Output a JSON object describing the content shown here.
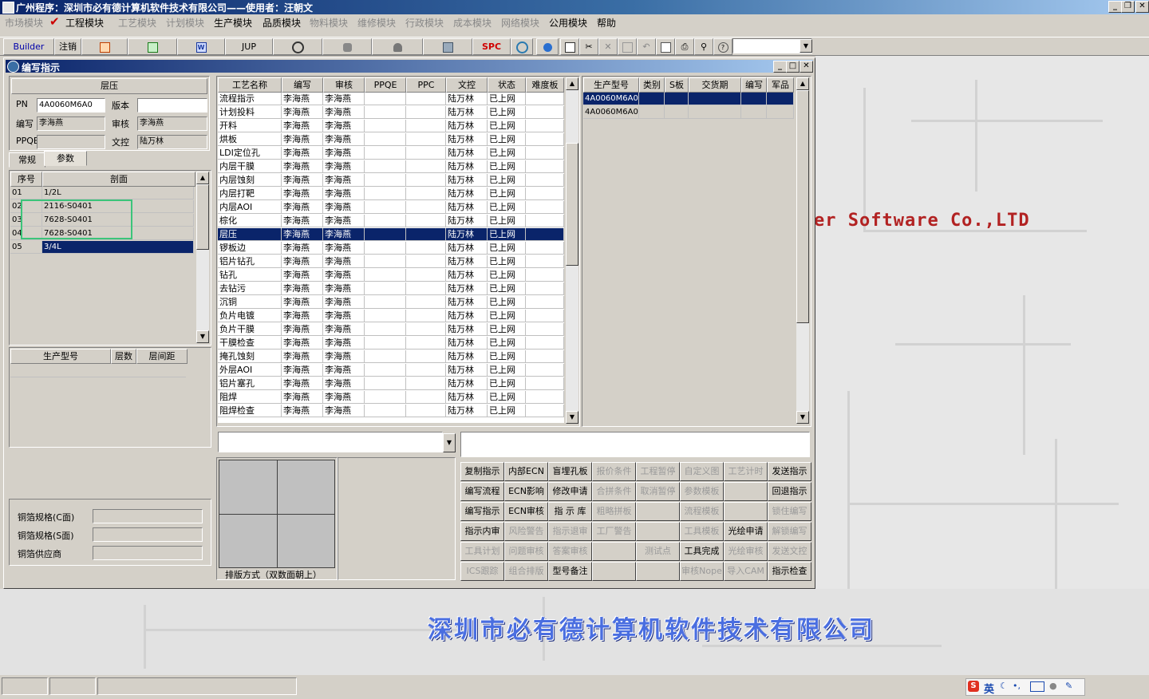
{
  "window": {
    "title": "广州程序：深圳市必有德计算机软件技术有限公司——使用者：汪朝文"
  },
  "menu": {
    "items": [
      "市场模块",
      "工程模块",
      "工艺模块",
      "计划模块",
      "生产模块",
      "品质模块",
      "物料模块",
      "维修模块",
      "行政模块",
      "成本模块",
      "网络模块",
      "公用模块",
      "帮助"
    ]
  },
  "toolbar": {
    "builder": "Builder",
    "logout": "注销",
    "jup": "JUP",
    "spc": "SPC"
  },
  "child": {
    "title": "编写指示"
  },
  "left": {
    "section_title": "层压",
    "pn_label": "PN",
    "pn_value": "4A0060M6A0",
    "version_label": "版本",
    "version_value": "",
    "author_label": "编写",
    "author_value": "李海燕",
    "review_label": "审核",
    "review_value": "李海燕",
    "ppqe_label": "PPQE",
    "ppqe_value": "",
    "doc_label": "文控",
    "doc_value": "陆万林",
    "tabs": [
      "常规",
      "参数"
    ],
    "stack_headers": [
      "序号",
      "剖面"
    ],
    "stack_rows": [
      [
        "01",
        "1/2L"
      ],
      [
        "02",
        "2116-S0401"
      ],
      [
        "03",
        "7628-S0401"
      ],
      [
        "04",
        "7628-S0401"
      ],
      [
        "05",
        "3/4L"
      ]
    ],
    "model_headers": [
      "生产型号",
      "层数",
      "层间距"
    ],
    "copper_c_label": "铜箔规格(C面)",
    "copper_s_label": "铜箔规格(S面)",
    "copper_supplier_label": "铜箔供应商"
  },
  "process": {
    "headers": [
      "工艺名称",
      "编写",
      "审核",
      "PPQE",
      "PPC",
      "文控",
      "状态",
      "难度板"
    ],
    "rows": [
      [
        "流程指示",
        "李海燕",
        "李海燕",
        "",
        "",
        "陆万林",
        "已上网",
        ""
      ],
      [
        "计划投料",
        "李海燕",
        "李海燕",
        "",
        "",
        "陆万林",
        "已上网",
        ""
      ],
      [
        "开料",
        "李海燕",
        "李海燕",
        "",
        "",
        "陆万林",
        "已上网",
        ""
      ],
      [
        "烘板",
        "李海燕",
        "李海燕",
        "",
        "",
        "陆万林",
        "已上网",
        ""
      ],
      [
        "LDI定位孔",
        "李海燕",
        "李海燕",
        "",
        "",
        "陆万林",
        "已上网",
        ""
      ],
      [
        "内层干膜",
        "李海燕",
        "李海燕",
        "",
        "",
        "陆万林",
        "已上网",
        ""
      ],
      [
        "内层蚀刻",
        "李海燕",
        "李海燕",
        "",
        "",
        "陆万林",
        "已上网",
        ""
      ],
      [
        "内层打靶",
        "李海燕",
        "李海燕",
        "",
        "",
        "陆万林",
        "已上网",
        ""
      ],
      [
        "内层AOI",
        "李海燕",
        "李海燕",
        "",
        "",
        "陆万林",
        "已上网",
        ""
      ],
      [
        "棕化",
        "李海燕",
        "李海燕",
        "",
        "",
        "陆万林",
        "已上网",
        ""
      ],
      [
        "层压",
        "李海燕",
        "李海燕",
        "",
        "",
        "陆万林",
        "已上网",
        ""
      ],
      [
        "锣板边",
        "李海燕",
        "李海燕",
        "",
        "",
        "陆万林",
        "已上网",
        ""
      ],
      [
        "铝片钻孔",
        "李海燕",
        "李海燕",
        "",
        "",
        "陆万林",
        "已上网",
        ""
      ],
      [
        "钻孔",
        "李海燕",
        "李海燕",
        "",
        "",
        "陆万林",
        "已上网",
        ""
      ],
      [
        "去钻污",
        "李海燕",
        "李海燕",
        "",
        "",
        "陆万林",
        "已上网",
        ""
      ],
      [
        "沉铜",
        "李海燕",
        "李海燕",
        "",
        "",
        "陆万林",
        "已上网",
        ""
      ],
      [
        "负片电镀",
        "李海燕",
        "李海燕",
        "",
        "",
        "陆万林",
        "已上网",
        ""
      ],
      [
        "负片干膜",
        "李海燕",
        "李海燕",
        "",
        "",
        "陆万林",
        "已上网",
        ""
      ],
      [
        "干膜检查",
        "李海燕",
        "李海燕",
        "",
        "",
        "陆万林",
        "已上网",
        ""
      ],
      [
        "掩孔蚀刻",
        "李海燕",
        "李海燕",
        "",
        "",
        "陆万林",
        "已上网",
        ""
      ],
      [
        "外层AOI",
        "李海燕",
        "李海燕",
        "",
        "",
        "陆万林",
        "已上网",
        ""
      ],
      [
        "铝片塞孔",
        "李海燕",
        "李海燕",
        "",
        "",
        "陆万林",
        "已上网",
        ""
      ],
      [
        "阻焊",
        "李海燕",
        "李海燕",
        "",
        "",
        "陆万林",
        "已上网",
        ""
      ],
      [
        "阻焊检查",
        "李海燕",
        "李海燕",
        "",
        "",
        "陆万林",
        "已上网",
        ""
      ]
    ]
  },
  "models": {
    "headers": [
      "生产型号",
      "类别",
      "S板",
      "交货期",
      "编写",
      "军品"
    ],
    "rows": [
      [
        "4A0060M6A0",
        "",
        "",
        "",
        "",
        ""
      ],
      [
        "4A0060M6A0",
        "",
        "",
        "",
        "",
        ""
      ]
    ]
  },
  "layout_caption": "排版方式（双数面朝上）",
  "commands": [
    [
      "复制指示",
      "内部ECN",
      "盲埋孔板",
      "报价条件",
      "工程暂停",
      "自定义图",
      "工艺计时",
      "发送指示"
    ],
    [
      "编写流程",
      "ECN影响",
      "修改申请",
      "合拼条件",
      "取消暂停",
      "参数模板",
      "",
      "回退指示"
    ],
    [
      "编写指示",
      "ECN审核",
      "指 示 库",
      "粗略拼板",
      "",
      "流程模板",
      "",
      "锁住编写"
    ],
    [
      "指示内审",
      "风险警告",
      "指示退审",
      "工厂警告",
      "",
      "工具模板",
      "光绘申请",
      "解锁编写"
    ],
    [
      "工具计划",
      "问题审核",
      "答案审核",
      "",
      "测试点",
      "工具完成",
      "光绘审核",
      "发送文控"
    ],
    [
      "ICS跟踪",
      "组合排版",
      "型号备注",
      "",
      "",
      "审核Nope",
      "导入CAM",
      "指示检查"
    ]
  ],
  "commands_disabled": [
    [
      false,
      false,
      false,
      true,
      true,
      true,
      true,
      false
    ],
    [
      false,
      false,
      false,
      true,
      true,
      true,
      false,
      false
    ],
    [
      false,
      false,
      false,
      true,
      false,
      true,
      false,
      true
    ],
    [
      false,
      true,
      true,
      true,
      false,
      true,
      false,
      true
    ],
    [
      true,
      true,
      true,
      false,
      true,
      false,
      true,
      true
    ],
    [
      true,
      true,
      false,
      false,
      false,
      true,
      true,
      false
    ]
  ],
  "background": {
    "brand_text": "er Software Co.,LTD",
    "company_text": "深圳市必有德计算机软件技术有限公司"
  },
  "tray": {
    "ime": "英"
  }
}
